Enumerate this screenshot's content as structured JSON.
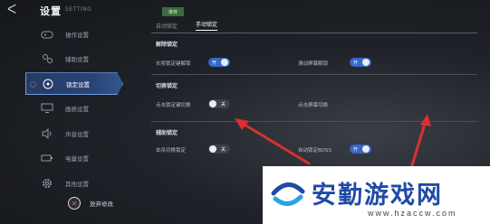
{
  "header": {
    "back_glyph": "ᐸ",
    "title": "设置",
    "title_en": "SETTING"
  },
  "sidebar": {
    "items": [
      {
        "label": "操作设置",
        "icon": "gamepad-icon",
        "active": false
      },
      {
        "label": "辅助设置",
        "icon": "assist-icon",
        "active": false
      },
      {
        "label": "锁定设置",
        "icon": "target-icon",
        "active": true
      },
      {
        "label": "画质设置",
        "icon": "monitor-icon",
        "active": false
      },
      {
        "label": "声音设置",
        "icon": "speaker-icon",
        "active": false
      },
      {
        "label": "电量设置",
        "icon": "battery-icon",
        "active": false
      },
      {
        "label": "其他设置",
        "icon": "gear-icon",
        "active": false
      }
    ]
  },
  "footer": {
    "discard_label": "放弃修改",
    "discard_icon": "✕"
  },
  "tabs": {
    "badge": "推荐",
    "items": [
      {
        "label": "自动锁定",
        "active": false
      },
      {
        "label": "手动锁定",
        "active": true
      }
    ]
  },
  "sections": {
    "lock_release": {
      "title": "解除锁定",
      "long_press": {
        "label": "长按锁定键解锁",
        "state": "开"
      },
      "swipe": {
        "label": "滑动屏幕解锁",
        "state": "开"
      }
    },
    "switch_lock": {
      "title": "切换锁定",
      "tap_switch": {
        "label": "点击锁定键切换",
        "state": "关"
      },
      "tap_screen": {
        "label": "点击屏幕切换"
      }
    },
    "assist_lock": {
      "title": "辅助锁定",
      "hit_switch": {
        "label": "击杀切换锁定",
        "state": "关"
      },
      "auto_boss": {
        "label": "自动锁定BOSS",
        "state": "开"
      }
    }
  },
  "colors": {
    "accent": "#3767c9",
    "arrow": "#d9312f",
    "brand": "#1f4aa8"
  },
  "watermark": {
    "brand": "安勤游戏网",
    "url": "www.hzaccw.com"
  }
}
